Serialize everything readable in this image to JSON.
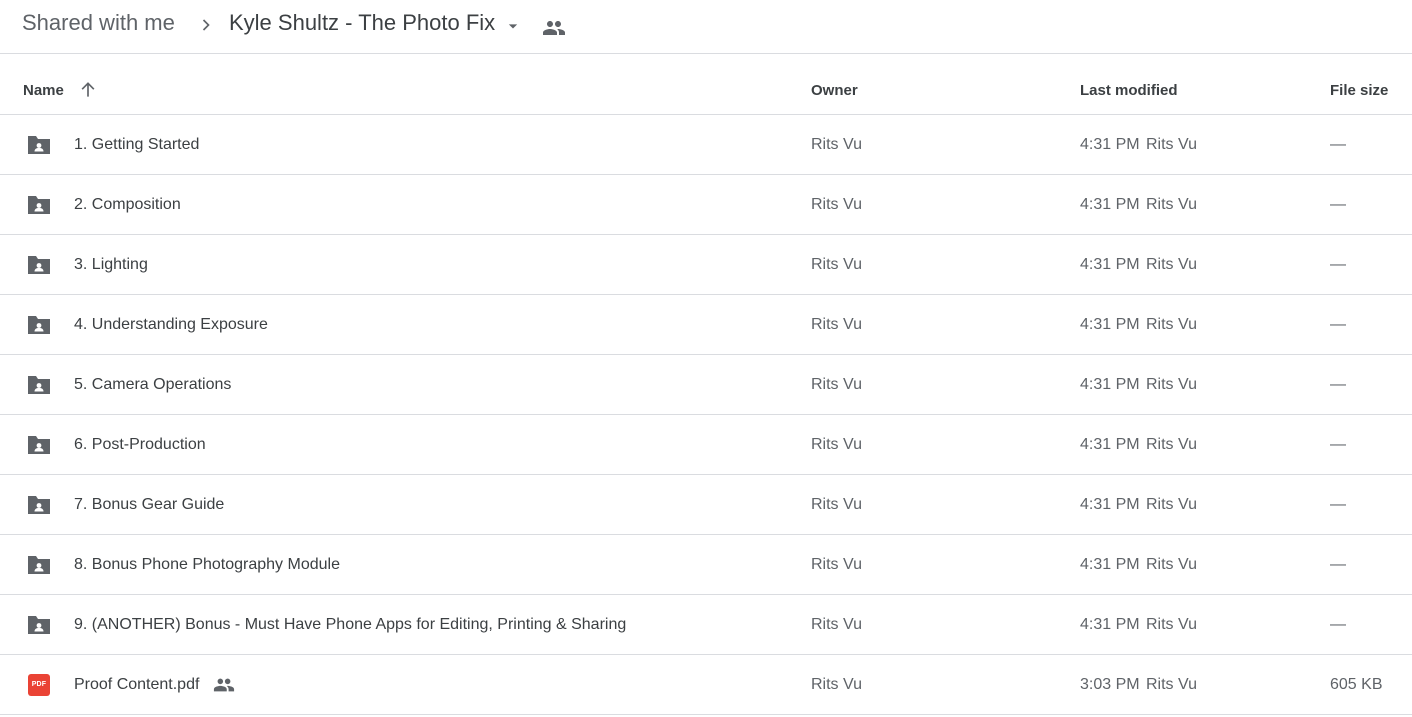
{
  "breadcrumb": {
    "root": "Shared with me",
    "current": "Kyle Shultz - The Photo Fix"
  },
  "columns": {
    "name": "Name",
    "owner": "Owner",
    "last_modified": "Last modified",
    "file_size": "File size"
  },
  "colors": {
    "folder_icon": "#5f6368",
    "pdf_icon": "#ea4335",
    "divider": "#dadce0"
  },
  "files": [
    {
      "name": "1. Getting Started",
      "type": "shared-folder",
      "owner": "Rits Vu",
      "modified_time": "4:31 PM",
      "modified_by": "Rits Vu",
      "size": "—"
    },
    {
      "name": "2. Composition",
      "type": "shared-folder",
      "owner": "Rits Vu",
      "modified_time": "4:31 PM",
      "modified_by": "Rits Vu",
      "size": "—"
    },
    {
      "name": "3. Lighting",
      "type": "shared-folder",
      "owner": "Rits Vu",
      "modified_time": "4:31 PM",
      "modified_by": "Rits Vu",
      "size": "—"
    },
    {
      "name": "4. Understanding Exposure",
      "type": "shared-folder",
      "owner": "Rits Vu",
      "modified_time": "4:31 PM",
      "modified_by": "Rits Vu",
      "size": "—"
    },
    {
      "name": "5. Camera Operations",
      "type": "shared-folder",
      "owner": "Rits Vu",
      "modified_time": "4:31 PM",
      "modified_by": "Rits Vu",
      "size": "—"
    },
    {
      "name": "6. Post-Production",
      "type": "shared-folder",
      "owner": "Rits Vu",
      "modified_time": "4:31 PM",
      "modified_by": "Rits Vu",
      "size": "—"
    },
    {
      "name": "7. Bonus Gear Guide",
      "type": "shared-folder",
      "owner": "Rits Vu",
      "modified_time": "4:31 PM",
      "modified_by": "Rits Vu",
      "size": "—"
    },
    {
      "name": "8. Bonus Phone Photography Module",
      "type": "shared-folder",
      "owner": "Rits Vu",
      "modified_time": "4:31 PM",
      "modified_by": "Rits Vu",
      "size": "—"
    },
    {
      "name": "9. (ANOTHER) Bonus - Must Have Phone Apps for Editing, Printing & Sharing",
      "type": "shared-folder",
      "owner": "Rits Vu",
      "modified_time": "4:31 PM",
      "modified_by": "Rits Vu",
      "size": "—"
    },
    {
      "name": "Proof Content.pdf",
      "type": "pdf",
      "icon_label": "PDF",
      "owner": "Rits Vu",
      "modified_time": "3:03 PM",
      "modified_by": "Rits Vu",
      "size": "605 KB"
    }
  ]
}
